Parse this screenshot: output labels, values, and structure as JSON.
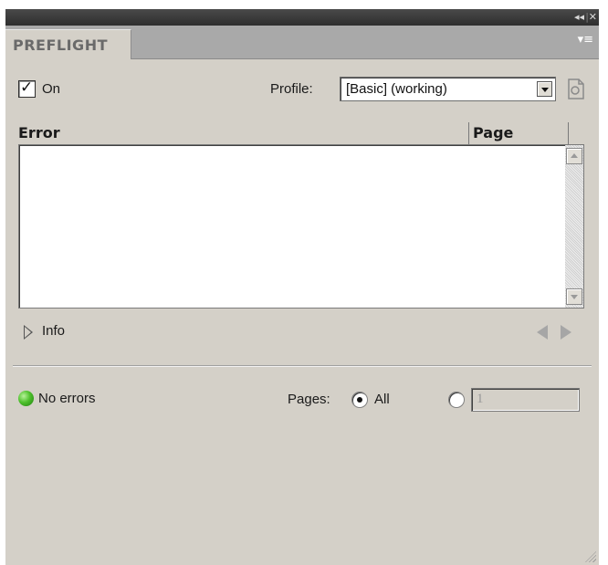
{
  "window": {
    "collapse_glyph": "◂◂",
    "separator": "|",
    "close_glyph": "✕",
    "menu_glyph": "▾≡"
  },
  "tab": {
    "label": "PREFLIGHT"
  },
  "preflight": {
    "on_checked": true,
    "on_label": "On",
    "profile_label": "Profile:",
    "profile_value": "[Basic] (working)"
  },
  "table": {
    "columns": [
      "Error",
      "Page"
    ],
    "rows": []
  },
  "info": {
    "label": "Info"
  },
  "status": {
    "text": "No errors",
    "color": "#3cb521"
  },
  "pages": {
    "label": "Pages:",
    "option_all": "All",
    "selected": "All",
    "range_value": "1"
  },
  "icons": {
    "profile_icon": "profile-doc-icon",
    "expand_icon": "disclosure-triangle-icon",
    "prev_icon": "arrow-left-icon",
    "next_icon": "arrow-right-icon"
  }
}
